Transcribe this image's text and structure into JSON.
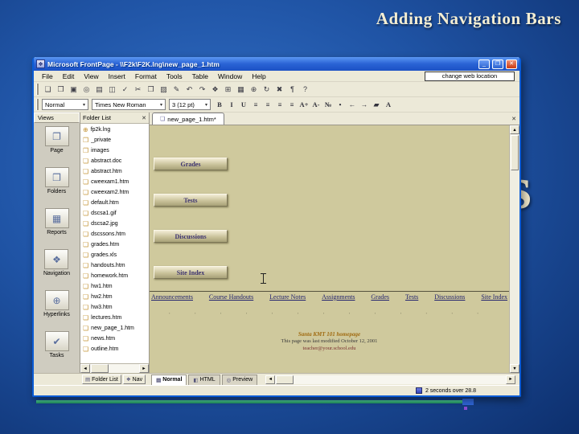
{
  "slide": {
    "title": "Adding Navigation Bars",
    "background_letter": "s"
  },
  "window": {
    "title": "Microsoft FrontPage - \\\\F2k\\F2K.lng\\new_page_1.htm",
    "app_icon_glyph": "❖",
    "controls": {
      "minimize": "_",
      "restore": "❐",
      "close": "✕"
    },
    "annotation": "change web location",
    "menu": {
      "items": [
        "File",
        "Edit",
        "View",
        "Insert",
        "Format",
        "Tools",
        "Table",
        "Window",
        "Help"
      ]
    },
    "standard_toolbar": {
      "icons": [
        {
          "name": "new-page-icon",
          "glyph": "❏"
        },
        {
          "name": "open-icon",
          "glyph": "❒"
        },
        {
          "name": "save-icon",
          "glyph": "▣"
        },
        {
          "name": "search-icon",
          "glyph": "◎"
        },
        {
          "name": "print-icon",
          "glyph": "▤"
        },
        {
          "name": "preview-in-browser-icon",
          "glyph": "◫"
        },
        {
          "name": "spelling-icon",
          "glyph": "✓"
        },
        {
          "name": "cut-icon",
          "glyph": "✂"
        },
        {
          "name": "copy-icon",
          "glyph": "❐"
        },
        {
          "name": "paste-icon",
          "glyph": "▨"
        },
        {
          "name": "format-painter-icon",
          "glyph": "✎"
        },
        {
          "name": "undo-icon",
          "glyph": "↶"
        },
        {
          "name": "redo-icon",
          "glyph": "↷"
        },
        {
          "name": "web-component-icon",
          "glyph": "❖"
        },
        {
          "name": "insert-table-icon",
          "glyph": "⊞"
        },
        {
          "name": "insert-picture-icon",
          "glyph": "▦"
        },
        {
          "name": "hyperlink-icon",
          "glyph": "⊕"
        },
        {
          "name": "refresh-icon",
          "glyph": "↻"
        },
        {
          "name": "stop-icon",
          "glyph": "✖"
        },
        {
          "name": "show-all-icon",
          "glyph": "¶"
        },
        {
          "name": "help-icon",
          "glyph": "?"
        }
      ]
    },
    "format_toolbar": {
      "style": "Normal",
      "font": "Times New Roman",
      "size": "3 (12 pt)",
      "buttons": [
        {
          "name": "bold-button",
          "glyph": "B"
        },
        {
          "name": "italic-button",
          "glyph": "I"
        },
        {
          "name": "underline-button",
          "glyph": "U"
        },
        {
          "name": "align-left-button",
          "glyph": "≡"
        },
        {
          "name": "align-center-button",
          "glyph": "≡"
        },
        {
          "name": "align-right-button",
          "glyph": "≡"
        },
        {
          "name": "justify-button",
          "glyph": "≡"
        },
        {
          "name": "increase-font-button",
          "glyph": "A+"
        },
        {
          "name": "decrease-font-button",
          "glyph": "A-"
        },
        {
          "name": "numbering-button",
          "glyph": "№"
        },
        {
          "name": "bullets-button",
          "glyph": "•"
        },
        {
          "name": "decrease-indent-button",
          "glyph": "←"
        },
        {
          "name": "increase-indent-button",
          "glyph": "→"
        },
        {
          "name": "highlight-button",
          "glyph": "▰"
        },
        {
          "name": "font-color-button",
          "glyph": "A"
        }
      ]
    },
    "views": {
      "header": "Views",
      "items": [
        {
          "label": "Page",
          "glyph": "❐",
          "name": "views-item-page"
        },
        {
          "label": "Folders",
          "glyph": "❒",
          "name": "views-item-folders"
        },
        {
          "label": "Reports",
          "glyph": "▦",
          "name": "views-item-reports"
        },
        {
          "label": "Navigation",
          "glyph": "❖",
          "name": "views-item-navigation"
        },
        {
          "label": "Hyperlinks",
          "glyph": "⊕",
          "name": "views-item-hyperlinks"
        },
        {
          "label": "Tasks",
          "glyph": "✔",
          "name": "views-item-tasks"
        }
      ]
    },
    "folder_list": {
      "header": "Folder List",
      "files": [
        {
          "name": "fp2k.lng",
          "glyph": "⊕"
        },
        {
          "name": "_private",
          "glyph": "❒"
        },
        {
          "name": "images",
          "glyph": "❒"
        },
        {
          "name": "abstract.doc",
          "glyph": "❏"
        },
        {
          "name": "abstract.htm",
          "glyph": "❏"
        },
        {
          "name": "cweexam1.htm",
          "glyph": "❏"
        },
        {
          "name": "cweexam2.htm",
          "glyph": "❏"
        },
        {
          "name": "default.htm",
          "glyph": "❏"
        },
        {
          "name": "dscsa1.gif",
          "glyph": "❏"
        },
        {
          "name": "dscsa2.jpg",
          "glyph": "❏"
        },
        {
          "name": "dscssons.htm",
          "glyph": "❏"
        },
        {
          "name": "grades.htm",
          "glyph": "❏"
        },
        {
          "name": "grades.xls",
          "glyph": "❏"
        },
        {
          "name": "handouts.htm",
          "glyph": "❏"
        },
        {
          "name": "homework.htm",
          "glyph": "❏"
        },
        {
          "name": "hw1.htm",
          "glyph": "❏"
        },
        {
          "name": "hw2.htm",
          "glyph": "❏"
        },
        {
          "name": "hw3.htm",
          "glyph": "❏"
        },
        {
          "name": "lectures.htm",
          "glyph": "❏"
        },
        {
          "name": "new_page_1.htm",
          "glyph": "❏"
        },
        {
          "name": "news.htm",
          "glyph": "❏"
        },
        {
          "name": "outline.htm",
          "glyph": "❏"
        }
      ]
    },
    "editor": {
      "tab": "new_page_1.htm*",
      "nav_buttons": [
        "Grades",
        "Tests",
        "Discussions",
        "Site Index"
      ],
      "link_bar": [
        "Announcements",
        "Course Handouts",
        "Lecture Notes",
        "Assignments",
        "Grades",
        "Tests",
        "Discussions",
        "Site Index"
      ],
      "marks": [
        "∙",
        "∙",
        "∙",
        "∙",
        "∙",
        "∙",
        "∙",
        "∙",
        "∙",
        "∙",
        "∙",
        "∙",
        "∙"
      ],
      "footer": {
        "line1": "Santa KMT 101 homepage",
        "line2": "This page was last modified October 12, 2001",
        "line3": "teacher@your.school.edu"
      }
    },
    "bottom_bar": {
      "panel_toggles": [
        {
          "label": "Folder List",
          "glyph": "▤",
          "name": "folder-list-toggle"
        },
        {
          "label": "Nav",
          "glyph": "❖",
          "name": "nav-toggle"
        }
      ],
      "view_tabs": [
        {
          "label": "Normal",
          "glyph": "▤",
          "name": "tab-normal"
        },
        {
          "label": "HTML",
          "glyph": "◧",
          "name": "tab-html"
        },
        {
          "label": "Preview",
          "glyph": "◎",
          "name": "tab-preview"
        }
      ]
    },
    "status": {
      "text": "2 seconds over 28.8"
    }
  },
  "colors": {
    "slide_blue": "#1f53a4",
    "titlebar_blue": "#2a63d5",
    "chrome_tan": "#ece9d8",
    "page_tan": "#cfc99d",
    "link_navy": "#22226e",
    "close_red": "#cb3a12"
  }
}
